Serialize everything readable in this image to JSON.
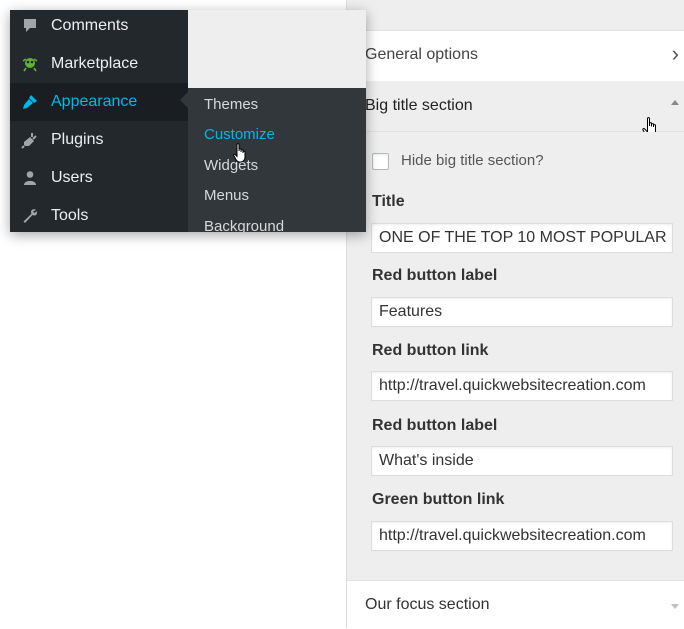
{
  "admin_menu": {
    "items": [
      {
        "label": "Comments",
        "icon": "comments-icon"
      },
      {
        "label": "Marketplace",
        "icon": "marketplace-icon"
      },
      {
        "label": "Appearance",
        "icon": "appearance-brush-icon",
        "active": true
      },
      {
        "label": "Plugins",
        "icon": "plugins-icon"
      },
      {
        "label": "Users",
        "icon": "users-icon"
      },
      {
        "label": "Tools",
        "icon": "tools-wrench-icon"
      }
    ],
    "submenu": [
      {
        "label": "Themes"
      },
      {
        "label": "Customize",
        "current": true
      },
      {
        "label": "Widgets"
      },
      {
        "label": "Menus"
      },
      {
        "label": "Background"
      }
    ],
    "colors": {
      "background": "#23282d",
      "submenu_background": "#32373c",
      "active_text": "#00b9eb",
      "text": "#eeeeee"
    }
  },
  "customizer": {
    "general_section": {
      "label": "General options",
      "icon": "chevron-right-icon"
    },
    "big_title_section": {
      "label": "Big title section",
      "icon": "caret-up-icon",
      "hide_checkbox_label": "Hide big title section?",
      "hide_checked": false,
      "fields": [
        {
          "label": "Title",
          "value": "ONE OF THE TOP 10 MOST POPULAR"
        },
        {
          "label": "Red button label",
          "value": "Features"
        },
        {
          "label": "Red button link",
          "value": "http://travel.quickwebsitecreation.com"
        },
        {
          "label": "Red button label",
          "value": "What's inside"
        },
        {
          "label": "Green button link",
          "value": "http://travel.quickwebsitecreation.com"
        }
      ]
    },
    "focus_section": {
      "label": "Our focus section",
      "icon": "caret-down-icon"
    }
  }
}
